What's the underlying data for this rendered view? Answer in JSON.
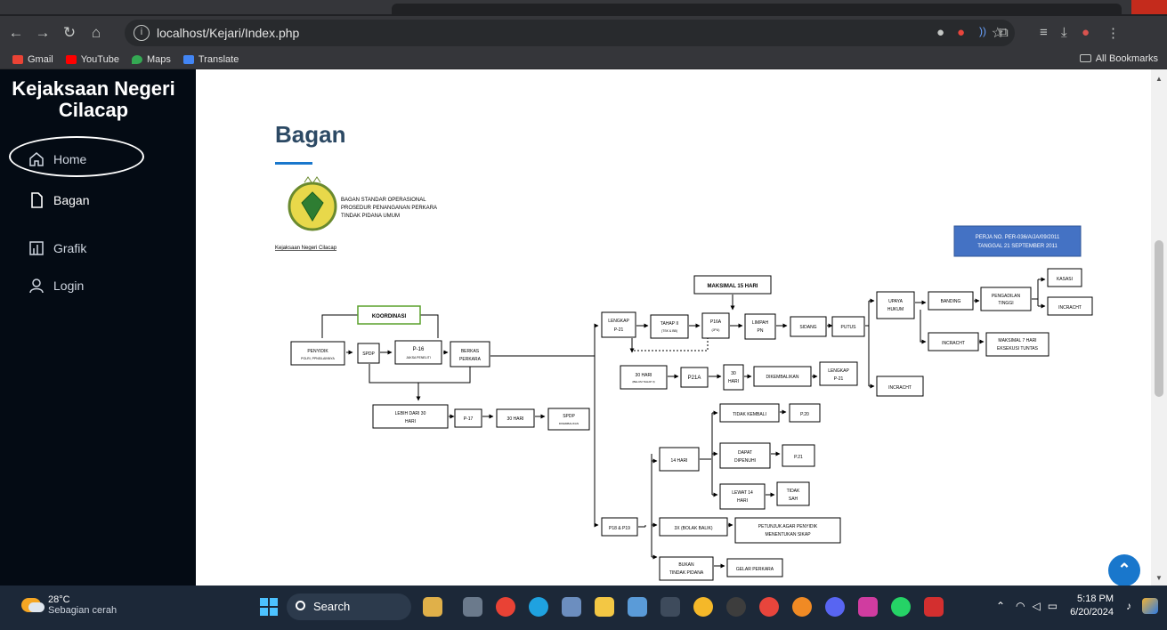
{
  "browser": {
    "url": "localhost/Kejari/Index.php",
    "bookmarks": [
      "Gmail",
      "YouTube",
      "Maps",
      "Translate"
    ],
    "all_bookmarks": "All Bookmarks"
  },
  "sidebar": {
    "brand": "Kejaksaan Negeri Cilacap",
    "items": [
      {
        "label": "Home",
        "icon": "home-icon"
      },
      {
        "label": "Bagan",
        "icon": "file-icon"
      },
      {
        "label": "Grafik",
        "icon": "chart-icon"
      },
      {
        "label": "Login",
        "icon": "user-icon"
      }
    ]
  },
  "page": {
    "title": "Bagan"
  },
  "diagram": {
    "header_lines": [
      "BAGAN STANDAR OPERASIONAL",
      "PROSEDUR PENANGANAN PERKARA",
      "TINDAK PIDANA UMUM"
    ],
    "org_caption": "Kejaksaan Negeri Cilacap",
    "perja_lines": [
      "PERJA NO. PER-036/A/JA/09/2011",
      "TANGGAL 21 SEPTEMBER 2011"
    ],
    "maksimal": "MAKSIMAL 15 HARI",
    "koordinasi": "KOORDINASI",
    "penyidik": [
      "PENYIDIK",
      "POLRI, PPNS/LAINNYA"
    ],
    "spdp": "SPDP",
    "p16": [
      "P-16",
      "JAKSA PENELITI"
    ],
    "berkas": [
      "BERKAS",
      "PERKARA"
    ],
    "lebih30": [
      "LEBIH DARI 30",
      "HARI"
    ],
    "p17": "P-17",
    "hari30": "30 HARI",
    "spdp_kembali": [
      "SPDP",
      "DIKEMBALIKAN"
    ],
    "lengkap": [
      "LENGKAP",
      "P-21"
    ],
    "tahap2": [
      "TAHAP II",
      "(TSK & BB)"
    ],
    "p16a": [
      "P16A",
      "(JPU)"
    ],
    "limpah": [
      "LIMPAH",
      "PN"
    ],
    "sidang": "SIDANG",
    "putus": "PUTUS",
    "upaya": [
      "UPAYA",
      "HUKUM"
    ],
    "banding": "BANDING",
    "pengadilan": [
      "PENGADILAN",
      "TINGGI"
    ],
    "kasasi": "KASASI",
    "incracht": "INCRACHT",
    "maks7": [
      "MAKSIMAL 7 HARI",
      "EKSEKUSI TUNTAS"
    ],
    "hari30b": [
      "30 HARI",
      "(BELUM TAHAP II)"
    ],
    "p21a": "P21A",
    "hari30c": [
      "30",
      "HARI"
    ],
    "dikembalikan": "DIKEMBALIKAN",
    "lengkap2": [
      "LENGKAP",
      "P-21"
    ],
    "tidak_kembali": "TIDAK KEMBALI",
    "p20": "P.20",
    "hari14": "14 HARI",
    "dapat": [
      "DAPAT",
      "DIPENUHI"
    ],
    "p21b": "P.21",
    "lewat14": [
      "LEWAT 14",
      "HARI"
    ],
    "tidak_sah": [
      "TIDAK",
      "SAH"
    ],
    "p18": "P18 & P19",
    "bolak": "3X (BOLAK BALIK)",
    "petunjuk": [
      "PETUNJUK AGAR PENYIDIK",
      "MENENTUKAN SIKAP"
    ],
    "bukan": [
      "BUKAN",
      "TINDAK PIDANA"
    ],
    "gelar": "GELAR PERKARA"
  },
  "taskbar": {
    "temp": "28°C",
    "weather": "Sebagian cerah",
    "search": "Search",
    "time": "5:18 PM",
    "date": "6/20/2024"
  },
  "colors": {
    "sidebar_bg": "#040b14",
    "title_color": "#2c4964",
    "accent": "#1977cc",
    "perja_bg": "#4472c4"
  }
}
